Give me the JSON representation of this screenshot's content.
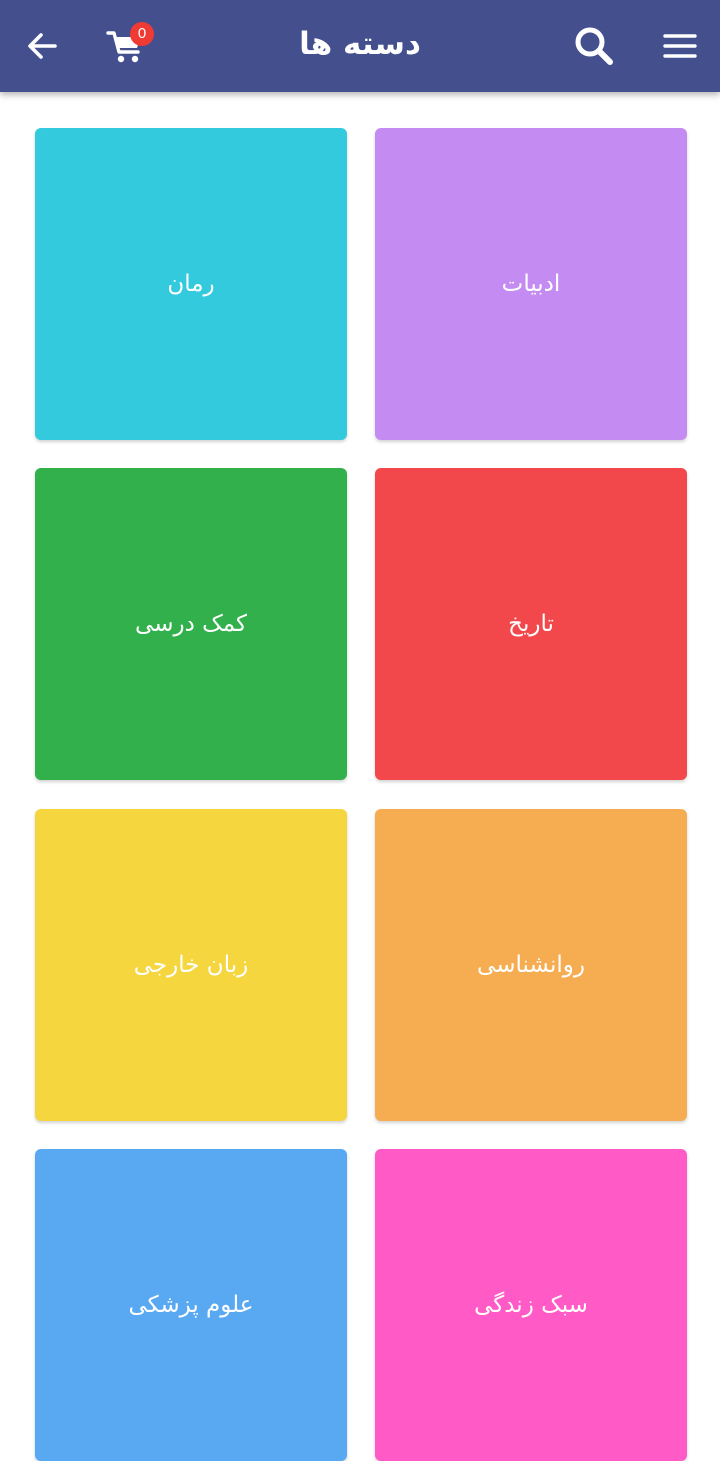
{
  "appbar": {
    "title": "دسته ها",
    "cart_count": "0",
    "icons": {
      "back": "arrow-left-icon",
      "cart": "shopping-cart-icon",
      "search": "search-icon",
      "menu": "hamburger-menu-icon"
    },
    "color": "#444f8e"
  },
  "categories": [
    {
      "label": "ادبیات",
      "color": "#c48cf2"
    },
    {
      "label": "رمان",
      "color": "#33cade"
    },
    {
      "label": "تاریخ",
      "color": "#f2474b"
    },
    {
      "label": "کمک درسی",
      "color": "#31b04c"
    },
    {
      "label": "روانشناسی",
      "color": "#f6ad51"
    },
    {
      "label": "زبان خارجی",
      "color": "#f5d63f"
    },
    {
      "label": "سبک زندگی",
      "color": "#ff5ac6"
    },
    {
      "label": "علوم پزشکی",
      "color": "#59a9f2"
    }
  ]
}
